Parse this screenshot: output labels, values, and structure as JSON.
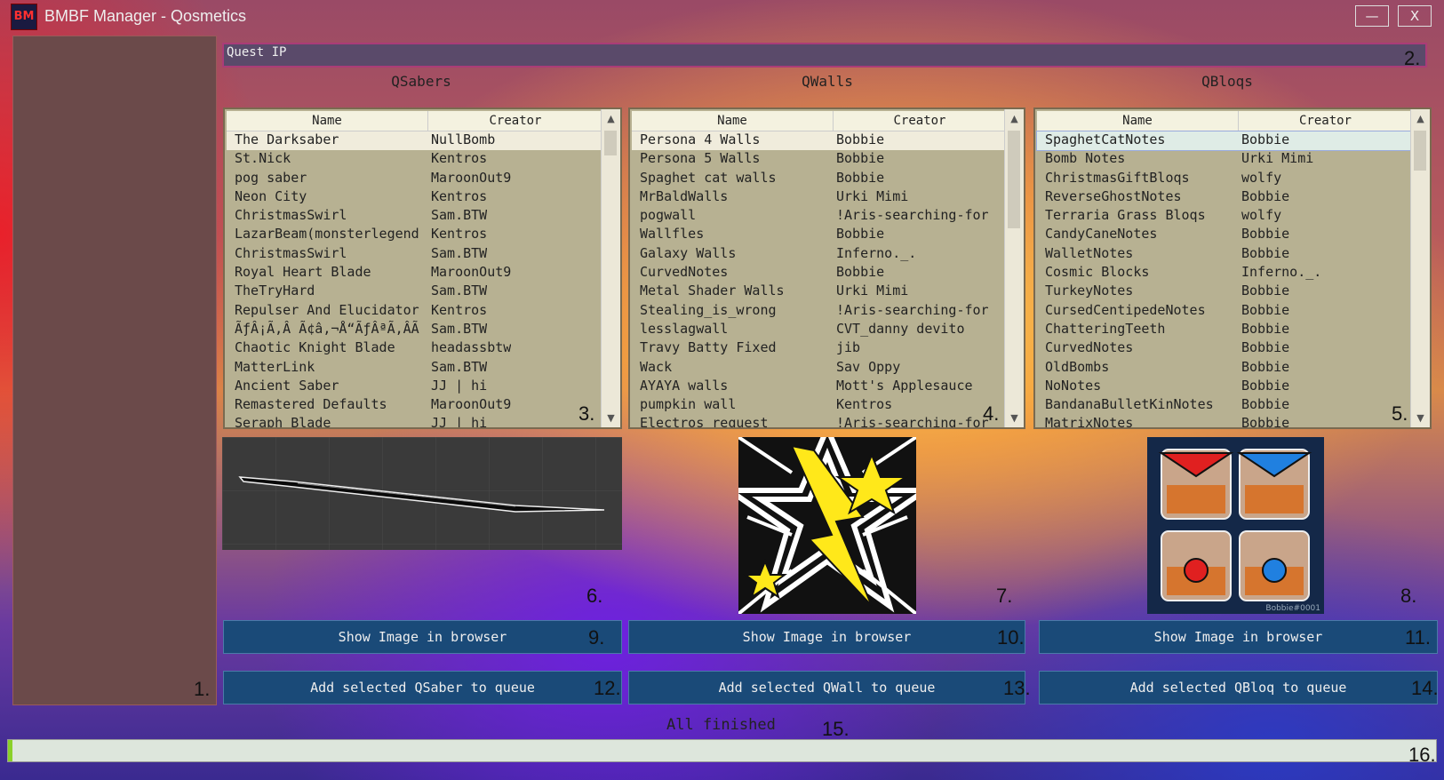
{
  "window": {
    "title": "BMBF Manager - Qosmetics",
    "minimize_label": "—",
    "close_label": "X",
    "icon_text": "BM"
  },
  "quest_ip": {
    "value": "Quest IP"
  },
  "status": {
    "text": "All finished",
    "progress": 0.003
  },
  "callouts": [
    "1.",
    "2.",
    "3.",
    "4.",
    "5.",
    "6.",
    "7.",
    "8.",
    "9.",
    "10.",
    "11.",
    "12.",
    "13.",
    "14.",
    "15.",
    "16."
  ],
  "columns": {
    "name": "Name",
    "creator": "Creator"
  },
  "qsabers": {
    "title": "QSabers",
    "rows": [
      [
        "The Darksaber",
        "NullBomb"
      ],
      [
        "St.Nick",
        "Kentros"
      ],
      [
        "pog saber",
        "MaroonOut9"
      ],
      [
        "Neon City",
        "Kentros"
      ],
      [
        "ChristmasSwirl",
        "Sam.BTW"
      ],
      [
        "LazarBeam(monsterlegend",
        "Kentros"
      ],
      [
        "ChristmasSwirl",
        "Sam.BTW"
      ],
      [
        "Royal Heart Blade",
        "MaroonOut9"
      ],
      [
        "TheTryHard",
        "Sam.BTW"
      ],
      [
        "Repulser And Elucidator",
        "Kentros"
      ],
      [
        "ÃƒÂ¡Ã‚Â Ã¢â‚¬Å“ÃƒÂªÃ‚ÂÃ",
        "Sam.BTW"
      ],
      [
        "Chaotic Knight Blade",
        "headassbtw"
      ],
      [
        "MatterLink",
        "Sam.BTW"
      ],
      [
        "Ancient Saber",
        "JJ | hi"
      ],
      [
        "Remastered Defaults",
        "MaroonOut9"
      ],
      [
        "Seraph Blade",
        "JJ | hi"
      ]
    ],
    "show_image_label": "Show Image in browser",
    "add_label": "Add selected QSaber to queue"
  },
  "qwalls": {
    "title": "QWalls",
    "rows": [
      [
        "Persona 4 Walls",
        "Bobbie"
      ],
      [
        "Persona 5 Walls",
        "Bobbie"
      ],
      [
        "Spaghet cat walls",
        "Bobbie"
      ],
      [
        "MrBaldWalls",
        "Urki Mimi"
      ],
      [
        "pogwall",
        "!Aris-searching-for"
      ],
      [
        "Wallfles",
        "Bobbie"
      ],
      [
        "Galaxy Walls",
        "Inferno._."
      ],
      [
        "CurvedNotes",
        "Bobbie"
      ],
      [
        "Metal Shader Walls",
        "Urki Mimi"
      ],
      [
        "Stealing_is_wrong",
        "!Aris-searching-for"
      ],
      [
        "lesslagwall",
        "CVT_danny devito"
      ],
      [
        "Travy Batty Fixed",
        "jib"
      ],
      [
        "Wack",
        "Sav Oppy"
      ],
      [
        "AYAYA walls",
        "Mott's Applesauce"
      ],
      [
        "pumpkin wall",
        "Kentros"
      ],
      [
        "Electros_request",
        "!Aris-searching-for"
      ]
    ],
    "show_image_label": "Show Image in browser",
    "add_label": "Add selected QWall to queue"
  },
  "qbloqs": {
    "title": "QBloqs",
    "rows": [
      [
        "SpaghetCatNotes",
        "Bobbie"
      ],
      [
        "Bomb Notes",
        "Urki Mimi"
      ],
      [
        "ChristmasGiftBloqs",
        "wolfy"
      ],
      [
        "ReverseGhostNotes",
        "Bobbie"
      ],
      [
        "Terraria Grass Bloqs",
        "wolfy"
      ],
      [
        "CandyCaneNotes",
        "Bobbie"
      ],
      [
        "WalletNotes",
        "Bobbie"
      ],
      [
        "Cosmic Blocks",
        "Inferno._."
      ],
      [
        "TurkeyNotes",
        "Bobbie"
      ],
      [
        "CursedCentipedeNotes",
        "Bobbie"
      ],
      [
        "ChatteringTeeth",
        "Bobbie"
      ],
      [
        "CurvedNotes",
        "Bobbie"
      ],
      [
        "OldBombs",
        "Bobbie"
      ],
      [
        "NoNotes",
        "Bobbie"
      ],
      [
        "BandanaBulletKinNotes",
        "Bobbie"
      ],
      [
        "MatrixNotes",
        "Bobbie"
      ]
    ],
    "show_image_label": "Show Image in browser",
    "add_label": "Add selected QBloq to queue",
    "preview_caption": "Bobbie#0001"
  }
}
